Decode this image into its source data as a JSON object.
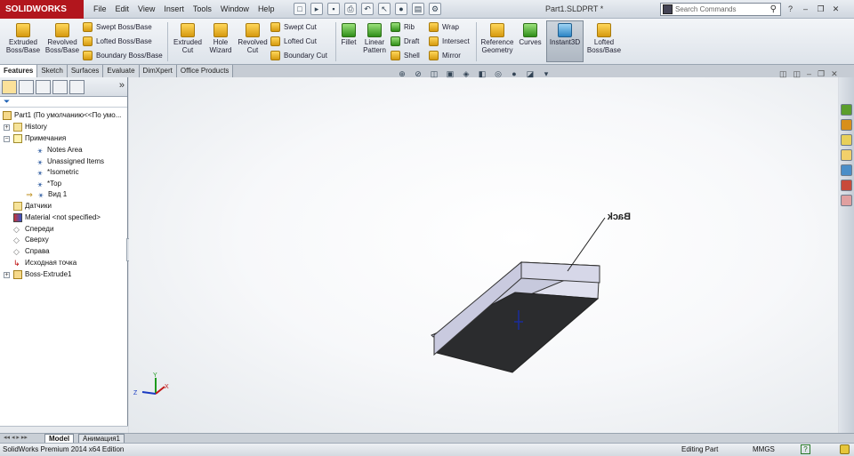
{
  "app": {
    "name": "SOLIDWORKS",
    "document_title": "Part1.SLDPRT *",
    "edition": "SolidWorks Premium 2014 x64 Edition"
  },
  "menu": [
    "File",
    "Edit",
    "View",
    "Insert",
    "Tools",
    "Window",
    "Help"
  ],
  "search": {
    "placeholder": "Search Commands"
  },
  "ribbon": {
    "extruded_boss": "Extruded Boss/Base",
    "revolved_boss": "Revolved Boss/Base",
    "swept_boss": "Swept Boss/Base",
    "lofted_boss": "Lofted Boss/Base",
    "boundary_boss": "Boundary Boss/Base",
    "extruded_cut": "Extruded Cut",
    "hole_wizard": "Hole Wizard",
    "revolved_cut": "Revolved Cut",
    "swept_cut": "Swept Cut",
    "lofted_cut": "Lofted Cut",
    "boundary_cut": "Boundary Cut",
    "fillet": "Fillet",
    "linear_pattern": "Linear Pattern",
    "rib": "Rib",
    "draft": "Draft",
    "shell": "Shell",
    "wrap": "Wrap",
    "intersect": "Intersect",
    "mirror": "Mirror",
    "reference_geometry": "Reference Geometry",
    "curves": "Curves",
    "instant3d": "Instant3D",
    "lofted_boss2": "Lofted Boss/Base"
  },
  "tabs": [
    "Features",
    "Sketch",
    "Surfaces",
    "Evaluate",
    "DimXpert",
    "Office Products"
  ],
  "tree": {
    "root": "Part1  (По умолчанию<<По умо...",
    "history": "History",
    "annotations": "Примечания",
    "notes_area": "Notes Area",
    "unassigned": "Unassigned Items",
    "isometric": "*Isometric",
    "top": "*Top",
    "view1": "Вид 1",
    "sensors": "Датчики",
    "material": "Material <not specified>",
    "front": "Спереди",
    "top_plane": "Сверху",
    "right": "Справа",
    "origin": "Исходная точка",
    "boss_extrude": "Boss-Extrude1"
  },
  "bottom_tabs": [
    "Model",
    "Анимация1"
  ],
  "status": {
    "mode": "Editing Part",
    "units": "MMGS",
    "help": "?"
  },
  "annotation_text": "Back",
  "triad": {
    "x": "X",
    "y": "Y",
    "z": "Z"
  },
  "colors": {
    "brand": "#b2161d",
    "face_dark": "#2b2c2e",
    "face_side": "#c7c9dd",
    "face_top": "#dfe0ee"
  }
}
